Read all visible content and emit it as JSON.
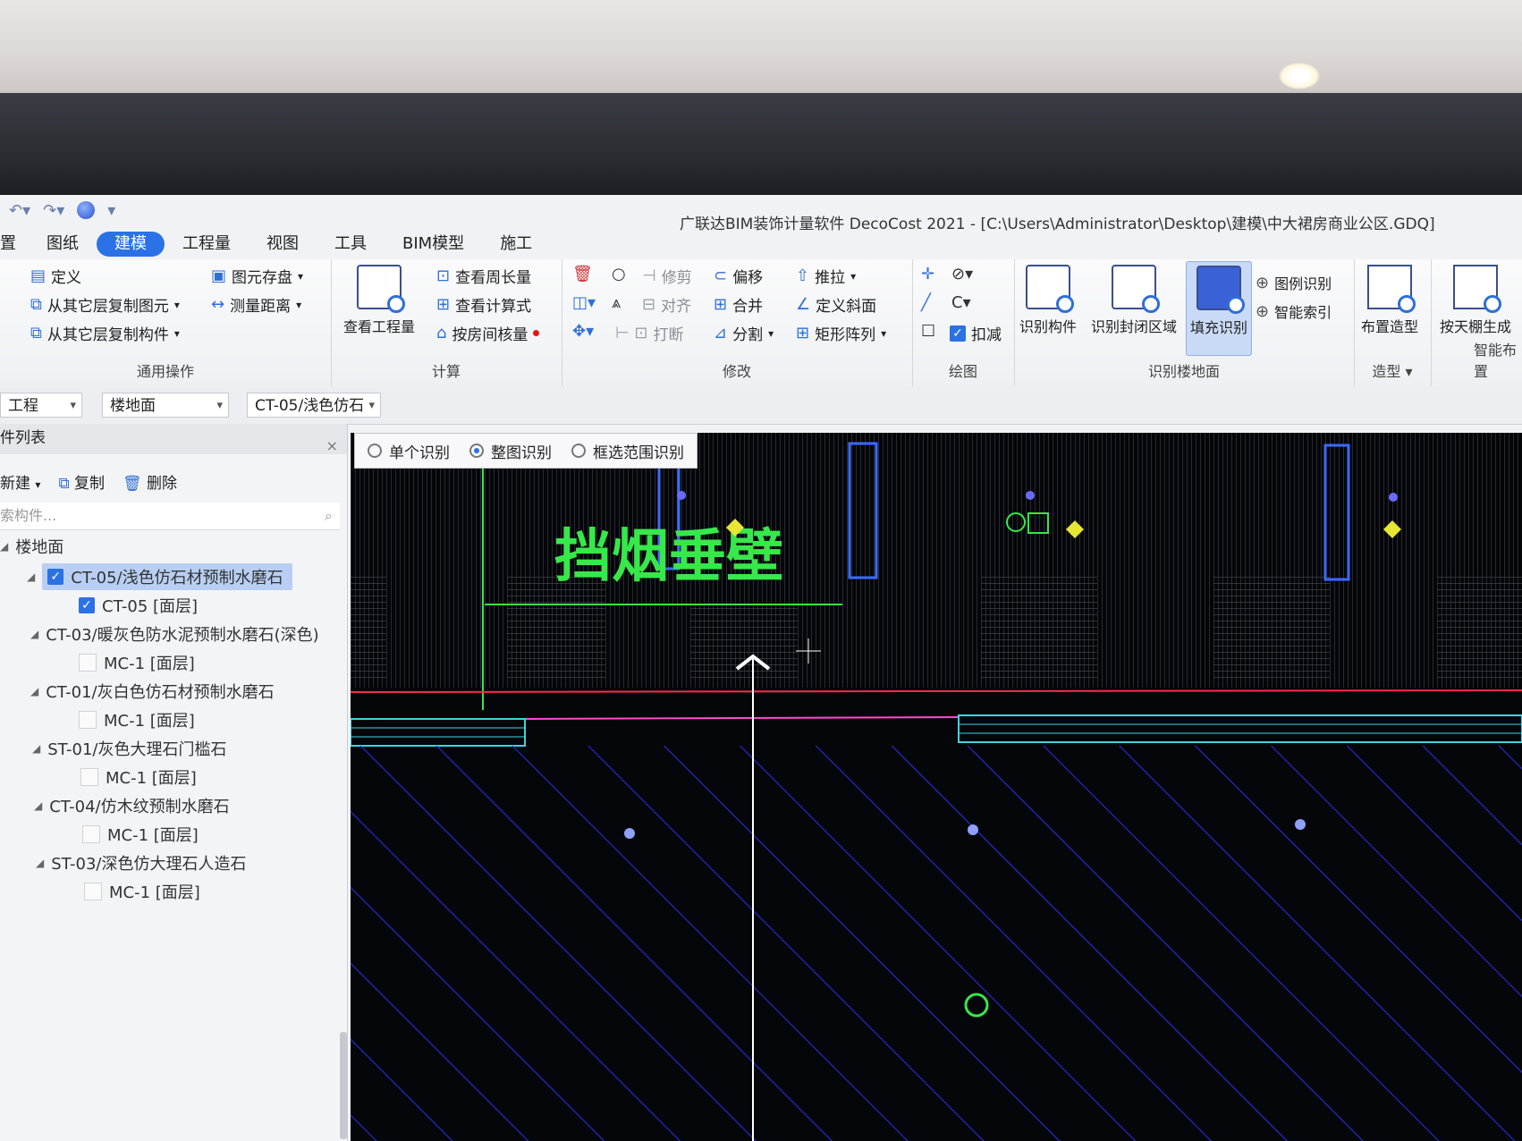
{
  "app": {
    "title": "广联达BIM装饰计量软件 DecoCost 2021 - [C:\\Users\\Administrator\\Desktop\\建模\\中大裙房商业公区.GDQ]"
  },
  "menu": {
    "tabs": [
      "置",
      "图纸",
      "建模",
      "工程量",
      "视图",
      "工具",
      "BIM模型",
      "施工"
    ],
    "active": "建模"
  },
  "ribbon": {
    "general": {
      "label": "通用操作",
      "define": "定义",
      "copy_from_layer": "从其它层复制图元",
      "copy_component": "从其它层复制构件",
      "save_elements": "图元存盘",
      "measure_distance": "测量距离"
    },
    "calc": {
      "label": "计算",
      "view_quantity": "查看工程量",
      "view_perimeter": "查看周长量",
      "view_formula": "查看计算式",
      "check_by_room": "按房间核量"
    },
    "modify": {
      "label": "修改",
      "trim": "修剪",
      "align": "对齐",
      "break": "打断",
      "offset": "偏移",
      "merge": "合并",
      "split": "分割",
      "push_pull": "推拉",
      "define_slope": "定义斜面",
      "rect_array": "矩形阵列"
    },
    "draw": {
      "label": "绘图",
      "deduct": "扣减"
    },
    "recognize": {
      "label": "识别楼地面",
      "recognize_component": "识别构件",
      "recognize_closed": "识别封闭区域",
      "fill_recognize": "填充识别",
      "legend_recognize": "图例识别",
      "smart_index": "智能索引"
    },
    "shape": {
      "label": "造型",
      "place_shape": "布置造型"
    },
    "smart": {
      "label": "智能布置",
      "gen_by_ceiling": "按天棚生成"
    }
  },
  "selectors": {
    "project": "工程",
    "floor_type": "楼地面",
    "component": "CT-05/浅色仿石"
  },
  "panel": {
    "title": "件列表",
    "new": "新建",
    "copy": "复制",
    "delete": "删除",
    "search_placeholder": "索构件...",
    "root": "楼地面",
    "items": [
      {
        "name": "CT-05/浅色仿石材预制水磨石",
        "child": "CT-05 [面层]"
      },
      {
        "name": "CT-03/暖灰色防水泥预制水磨石(深色)",
        "child": "MC-1 [面层]"
      },
      {
        "name": "CT-01/灰白色仿石材预制水磨石",
        "child": "MC-1 [面层]"
      },
      {
        "name": "ST-01/灰色大理石门槛石",
        "child": "MC-1 [面层]"
      },
      {
        "name": "CT-04/仿木纹预制水磨石",
        "child": "MC-1 [面层]"
      },
      {
        "name": "ST-03/深色仿大理石人造石",
        "child": "MC-1 [面层]"
      }
    ]
  },
  "canvas": {
    "modes": [
      "单个识别",
      "整图识别",
      "框选范围识别"
    ],
    "selected_mode": "整图识别",
    "annotation": "挡烟垂壁",
    "colors": {
      "background": "#05060a",
      "hatch": "#2b2ff0",
      "text": "#37e84a",
      "red_line": "#ff2a4a",
      "cyan_line": "#39d6e0"
    }
  }
}
